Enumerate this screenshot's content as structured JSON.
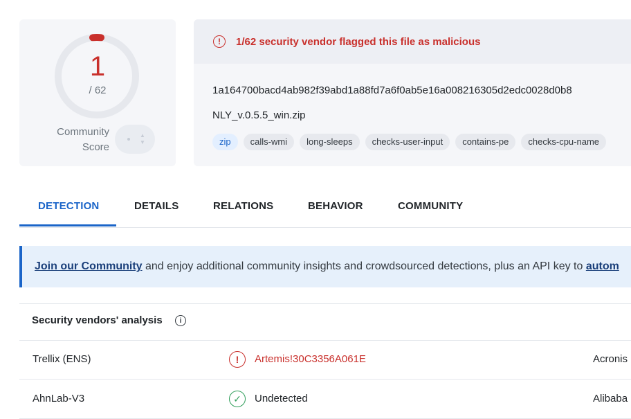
{
  "score": {
    "detected": "1",
    "total": "/ 62",
    "community_label": "Community\nScore",
    "accent_color": "#c9302c"
  },
  "file": {
    "alert": "1/62 security vendor flagged this file as malicious",
    "hash": "1a164700bacd4ab982f39abd1a88fd7a6f0ab5e16a008216305d2edc0028d0b8",
    "name": "NLY_v.0.5.5_win.zip",
    "tags": [
      "zip",
      "calls-wmi",
      "long-sleeps",
      "checks-user-input",
      "contains-pe",
      "checks-cpu-name"
    ]
  },
  "tabs": [
    "DETECTION",
    "DETAILS",
    "RELATIONS",
    "BEHAVIOR",
    "COMMUNITY"
  ],
  "banner": {
    "link": "Join our Community",
    "text": " and enjoy additional community insights and crowdsourced detections, plus an API key to ",
    "link2": "autom"
  },
  "vendors": {
    "title": "Security vendors' analysis",
    "rows": [
      {
        "vendor": "Trellix (ENS)",
        "result": "Artemis!30C3356A061E",
        "status": "malicious",
        "vendor2": "Acronis"
      },
      {
        "vendor": "AhnLab-V3",
        "result": "Undetected",
        "status": "undetected",
        "vendor2": "Alibaba"
      }
    ]
  }
}
